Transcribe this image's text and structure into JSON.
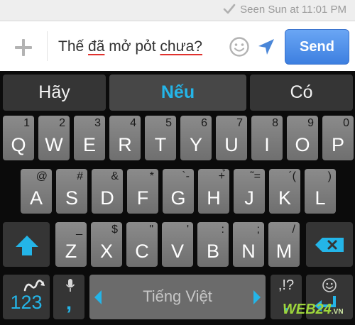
{
  "status": {
    "seen_text": "Seen Sun at 11:01 PM",
    "icon": "check-icon"
  },
  "compose": {
    "words": [
      "Thế",
      "đã",
      "mở",
      "pỏt",
      "chưa?"
    ],
    "misspelled": [
      1,
      4
    ],
    "send_label": "Send",
    "icons": [
      "plus-icon",
      "smiley-icon",
      "navigation-arrow-icon"
    ]
  },
  "keyboard": {
    "suggestions": [
      {
        "label": "Hãy",
        "active": false
      },
      {
        "label": "Nếu",
        "active": true
      },
      {
        "label": "Có",
        "active": false
      }
    ],
    "row1": [
      {
        "pri": "Q",
        "sec": "1"
      },
      {
        "pri": "W",
        "sec": "2"
      },
      {
        "pri": "E",
        "sec": "3"
      },
      {
        "pri": "R",
        "sec": "4"
      },
      {
        "pri": "T",
        "sec": "5"
      },
      {
        "pri": "Y",
        "sec": "6"
      },
      {
        "pri": "U",
        "sec": "7"
      },
      {
        "pri": "I",
        "sec": "8"
      },
      {
        "pri": "O",
        "sec": "9"
      },
      {
        "pri": "P",
        "sec": "0"
      }
    ],
    "row2": [
      {
        "pri": "A",
        "sec": "@"
      },
      {
        "pri": "S",
        "sec": "#"
      },
      {
        "pri": "D",
        "sec": "&"
      },
      {
        "pri": "F",
        "sec": "*"
      },
      {
        "pri": "G",
        "sec": "`-"
      },
      {
        "pri": "H",
        "sec": "+̉"
      },
      {
        "pri": "J",
        "sec": "˜="
      },
      {
        "pri": "K",
        "sec": "´("
      },
      {
        "pri": "L",
        "sec": ")"
      }
    ],
    "row3": [
      {
        "pri": "Z",
        "sec": "_"
      },
      {
        "pri": "X",
        "sec": "$"
      },
      {
        "pri": "C",
        "sec": "\""
      },
      {
        "pri": "V",
        "sec": "'"
      },
      {
        "pri": "B",
        "sec": ":"
      },
      {
        "pri": "N",
        "sec": ";"
      },
      {
        "pri": "M",
        "sec": "/"
      }
    ],
    "numbers_label": "123",
    "comma_label": ",",
    "space_label": "Tiếng Việt",
    "punct_label": ",!?",
    "dot_label": ".",
    "accent_color": "#24b5e8"
  },
  "watermark": {
    "main": "WEB24",
    "suffix": ".VN"
  }
}
